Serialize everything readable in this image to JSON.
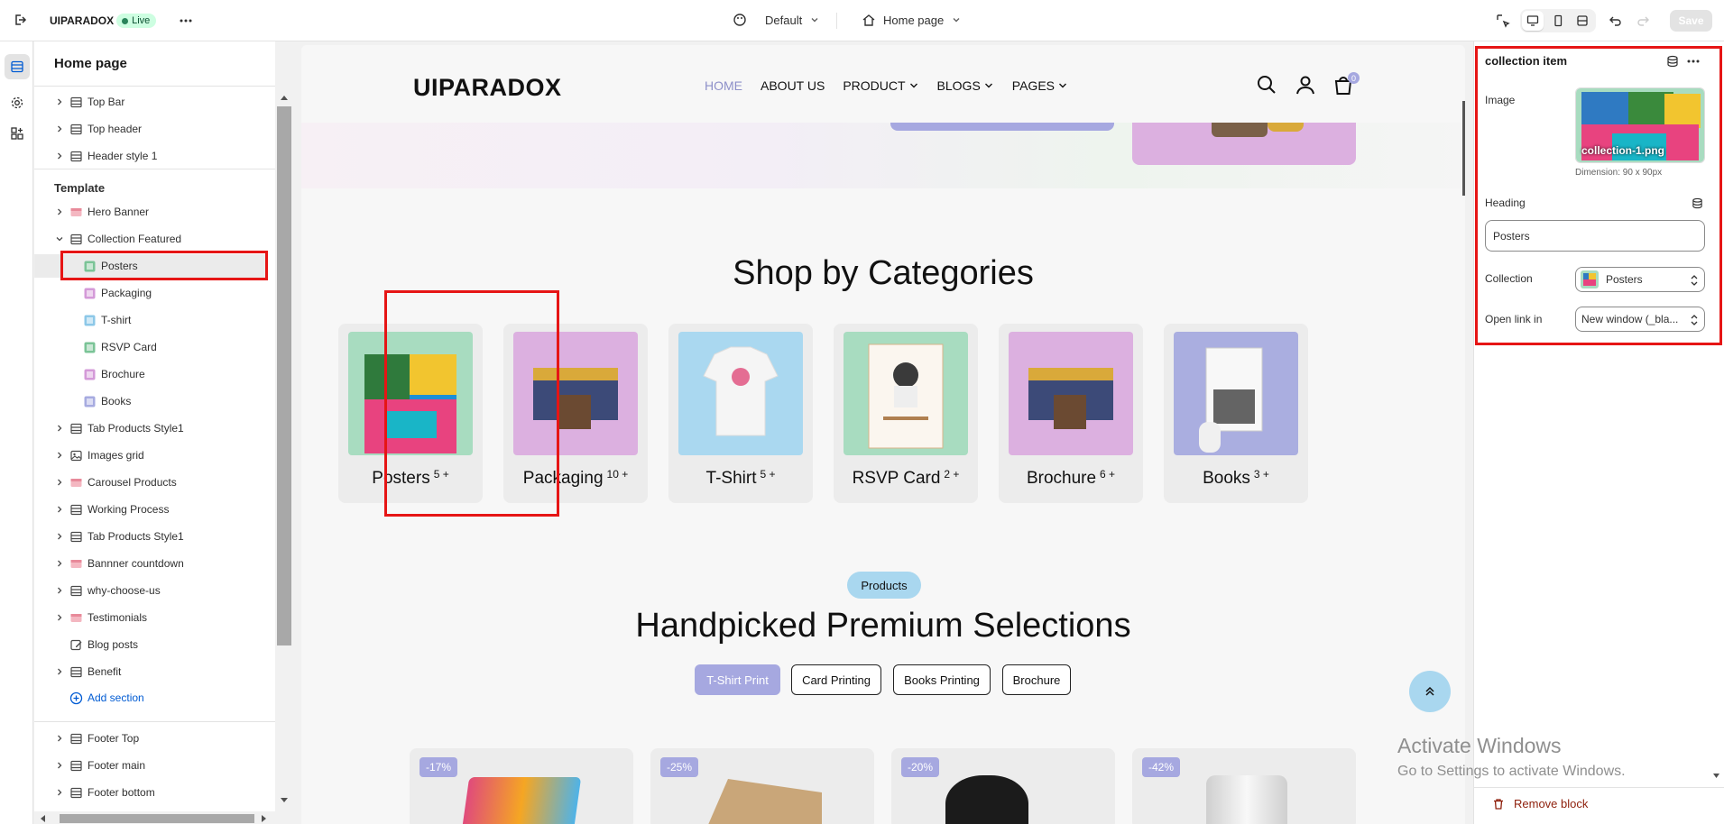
{
  "topbar": {
    "store_name": "UIPARADOX",
    "live_badge": "Live",
    "theme_select": "Default",
    "page_select": "Home page",
    "save_label": "Save"
  },
  "left_panel": {
    "title": "Home page",
    "header_items": [
      {
        "label": "Top Bar",
        "icon": "section-icon"
      },
      {
        "label": "Top header",
        "icon": "section-icon"
      },
      {
        "label": "Header style 1",
        "icon": "section-icon"
      }
    ],
    "template_label": "Template",
    "template_items": [
      {
        "label": "Hero Banner",
        "icon": "thumbnail-icon"
      },
      {
        "label": "Collection Featured",
        "icon": "section-icon",
        "expanded": true
      },
      {
        "label": "Posters",
        "child": true,
        "selected": true
      },
      {
        "label": "Packaging",
        "child": true
      },
      {
        "label": "T-shirt",
        "child": true
      },
      {
        "label": "RSVP Card",
        "child": true
      },
      {
        "label": "Brochure",
        "child": true
      },
      {
        "label": "Books",
        "child": true
      },
      {
        "label": "Tab Products Style1",
        "icon": "section-icon"
      },
      {
        "label": "Images grid",
        "icon": "image-icon"
      },
      {
        "label": "Carousel Products",
        "icon": "thumbnail-icon"
      },
      {
        "label": "Working Process",
        "icon": "section-icon"
      },
      {
        "label": "Tab Products Style1",
        "icon": "section-icon"
      },
      {
        "label": "Bannner countdown",
        "icon": "thumbnail-icon"
      },
      {
        "label": "why-choose-us",
        "icon": "section-icon"
      },
      {
        "label": "Testimonials",
        "icon": "thumbnail-icon"
      },
      {
        "label": "Blog posts",
        "icon": "edit-icon"
      },
      {
        "label": "Benefit",
        "icon": "section-icon"
      }
    ],
    "add_section": "Add section",
    "footer_items": [
      {
        "label": "Footer Top",
        "icon": "section-icon"
      },
      {
        "label": "Footer main",
        "icon": "section-icon"
      },
      {
        "label": "Footer bottom",
        "icon": "section-icon"
      }
    ]
  },
  "preview": {
    "logo": "UIPARADOX",
    "nav": [
      "HOME",
      "ABOUT US",
      "PRODUCT",
      "BLOGS",
      "PAGES"
    ],
    "cart_count": "0",
    "categories_heading": "Shop by Categories",
    "categories": [
      {
        "name": "Posters",
        "count": "5 +",
        "bg": "#a8dcc0"
      },
      {
        "name": "Packaging",
        "count": "10 +",
        "bg": "#dcb0e0"
      },
      {
        "name": "T-Shirt",
        "count": "5 +",
        "bg": "#aad8f0"
      },
      {
        "name": "RSVP Card",
        "count": "2 +",
        "bg": "#a8dcc0"
      },
      {
        "name": "Brochure",
        "count": "6 +",
        "bg": "#dcb0e0"
      },
      {
        "name": "Books",
        "count": "3 +",
        "bg": "#aaaee0"
      }
    ],
    "products_pill": "Products",
    "products_heading": "Handpicked Premium Selections",
    "tabs": [
      "T-Shirt Print",
      "Card Printing",
      "Books Printing",
      "Brochure"
    ],
    "discounts": [
      "-17%",
      "-25%",
      "-20%",
      "-42%"
    ]
  },
  "right_panel": {
    "title": "collection item",
    "image_label": "Image",
    "image_caption": "collection-1.png",
    "dimension": "Dimension: 90 x 90px",
    "heading_label": "Heading",
    "heading_value": "Posters",
    "collection_label": "Collection",
    "collection_value": "Posters",
    "open_link_label": "Open link in",
    "open_link_value": "New window (_bla...",
    "remove_block": "Remove block"
  },
  "watermark": {
    "line1": "Activate Windows",
    "line2": "Go to Settings to activate Windows."
  },
  "colors": {
    "accent": "#a6a8e0",
    "highlight": "#e61515",
    "live": "#29845a"
  }
}
